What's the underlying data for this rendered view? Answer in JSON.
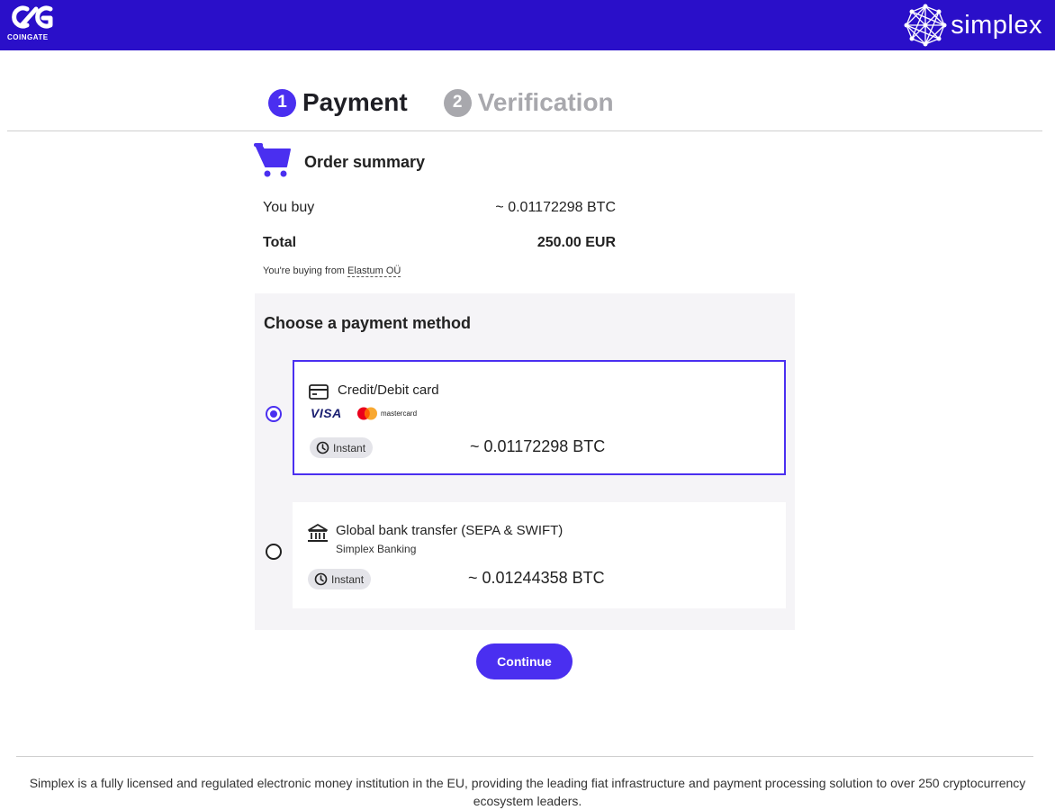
{
  "header": {
    "coingate_wordmark": "COINGATE",
    "simplex_wordmark": "simplex"
  },
  "steps": [
    {
      "number": "1",
      "label": "Payment"
    },
    {
      "number": "2",
      "label": "Verification"
    }
  ],
  "order_summary": {
    "title": "Order summary",
    "you_buy_label": "You buy",
    "you_buy_value": "~ 0.01172298 BTC",
    "total_label": "Total",
    "total_value": "250.00 EUR",
    "buying_from_text": "You're buying from",
    "merchant": "Elastum OÜ"
  },
  "payment_methods": {
    "title": "Choose a payment method",
    "options": [
      {
        "name": "Credit/Debit card",
        "logos": {
          "visa": "VISA",
          "mastercard": "mastercard"
        },
        "badge": "Instant",
        "amount": "~ 0.01172298 BTC",
        "selected": true
      },
      {
        "name": "Global bank transfer (SEPA & SWIFT)",
        "subtitle": "Simplex Banking",
        "badge": "Instant",
        "amount": "~ 0.01244358 BTC",
        "selected": false
      }
    ]
  },
  "continue_label": "Continue",
  "footer_text": "Simplex is a fully licensed and regulated electronic money institution in the EU, providing the leading fiat infrastructure and payment processing solution to over 250 cryptocurrency ecosystem leaders.",
  "colors": {
    "brand_bar": "#2a0fc9",
    "accent": "#4a2ff0",
    "inactive_step": "#a8a8ad",
    "panel_bg": "#f5f4f7"
  }
}
